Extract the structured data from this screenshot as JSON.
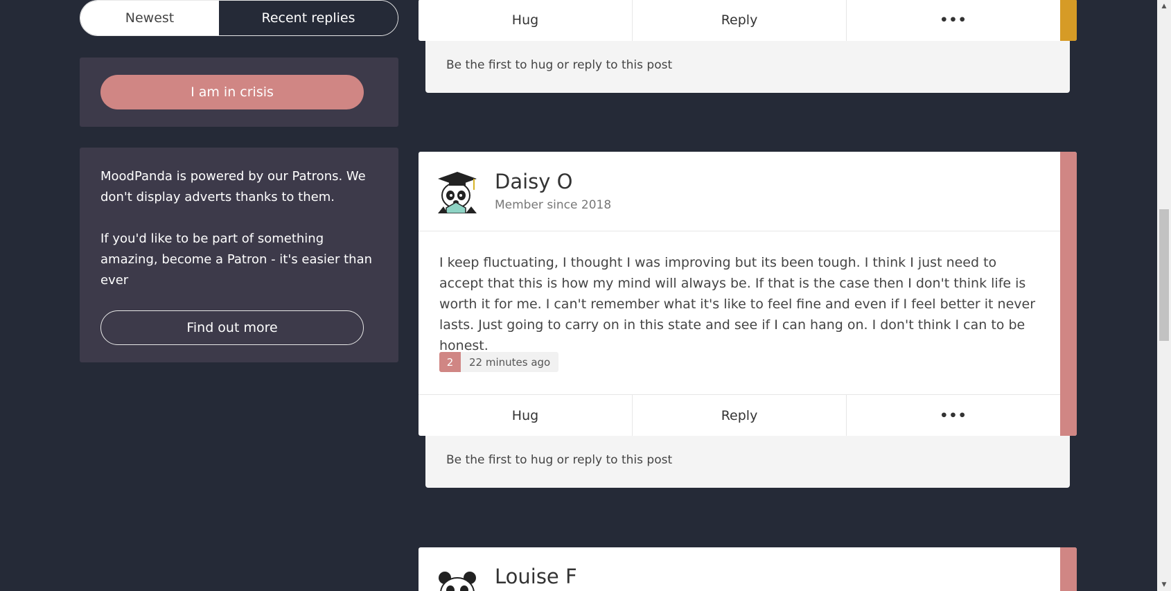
{
  "sidebar": {
    "tabs": [
      {
        "label": "Newest",
        "active": false
      },
      {
        "label": "Recent replies",
        "active": true
      }
    ],
    "crisis_button": "I am in crisis",
    "patron": {
      "line1": "MoodPanda is powered by our Patrons. We don't display adverts thanks to them.",
      "line2": "If you'd like to be part of something amazing, become a Patron - it's easier than ever",
      "button": "Find out more"
    }
  },
  "posts": [
    {
      "actions": {
        "hug": "Hug",
        "reply": "Reply",
        "more": "•••"
      },
      "reply_prompt": "Be the first to hug or reply to this post",
      "mood_color": "#d69b26"
    },
    {
      "username": "Daisy O",
      "member_since": "Member since 2018",
      "body": "I keep fluctuating, I thought I was improving but its been tough. I think I just need to accept that this is how my mind will always be. If that is the case then I don't think life is worth it for me. I can't remember what it's like to feel fine and even if I feel better it never lasts. Just going to carry on in this state and see if I can hang on. I don't think I can to be honest.",
      "mood": "2",
      "time": "22 minutes ago",
      "actions": {
        "hug": "Hug",
        "reply": "Reply",
        "more": "•••"
      },
      "reply_prompt": "Be the first to hug or reply to this post",
      "mood_color": "#d08684"
    },
    {
      "username": "Louise F",
      "mood_color": "#d08684"
    }
  ],
  "colors": {
    "background": "#252a37",
    "panel": "#3d3a4a",
    "crisis": "#d08684"
  }
}
